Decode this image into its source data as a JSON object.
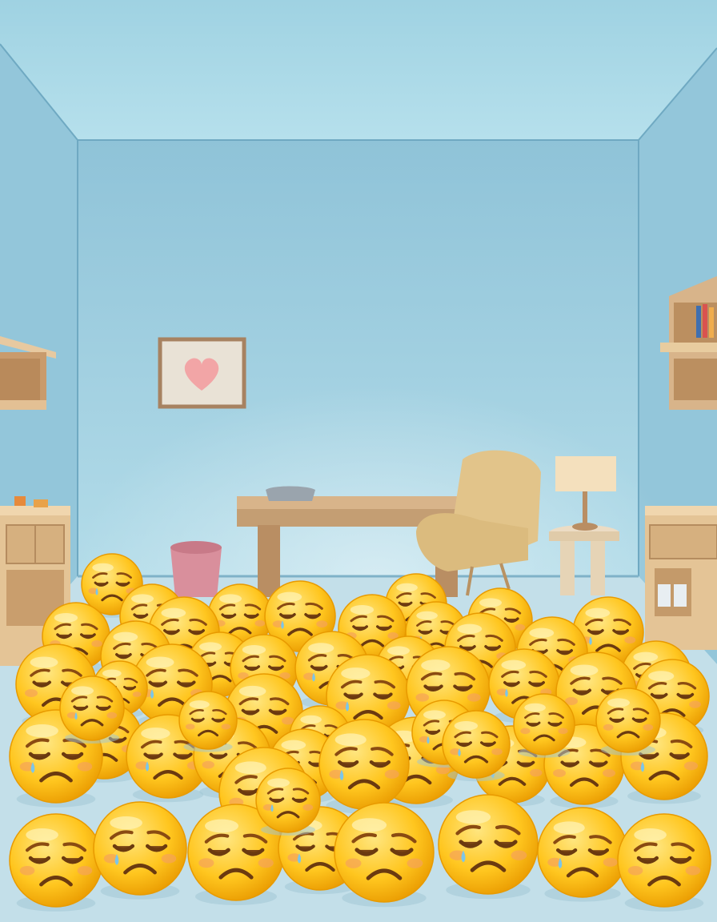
{
  "scene": {
    "description_tag": "room-full-of-sad-face-emoji",
    "palette": {
      "wall_back": "#a9d6e6",
      "wall_side": "#8fc4d8",
      "ceiling": "#b8e0ec",
      "floor": "#c4e1ea",
      "wood": "#d8b48a",
      "wood_dark": "#b98e63",
      "emoji_light": "#ffe066",
      "emoji_mid": "#ffc21a",
      "emoji_dark": "#e89a00",
      "blush": "#f5a25a",
      "tear": "#7cc6e8",
      "heart": "#f0a0a0",
      "chair": "#e2c48a",
      "bin": "#d98f9c"
    },
    "emoji_count": 55,
    "emoji_expression": "sad-crying",
    "furniture": [
      "framed-heart-picture",
      "desk",
      "armchair",
      "side-table",
      "table-lamp",
      "waste-bin",
      "left-wall-shelf",
      "left-dresser",
      "right-bookshelf",
      "right-dresser"
    ]
  }
}
